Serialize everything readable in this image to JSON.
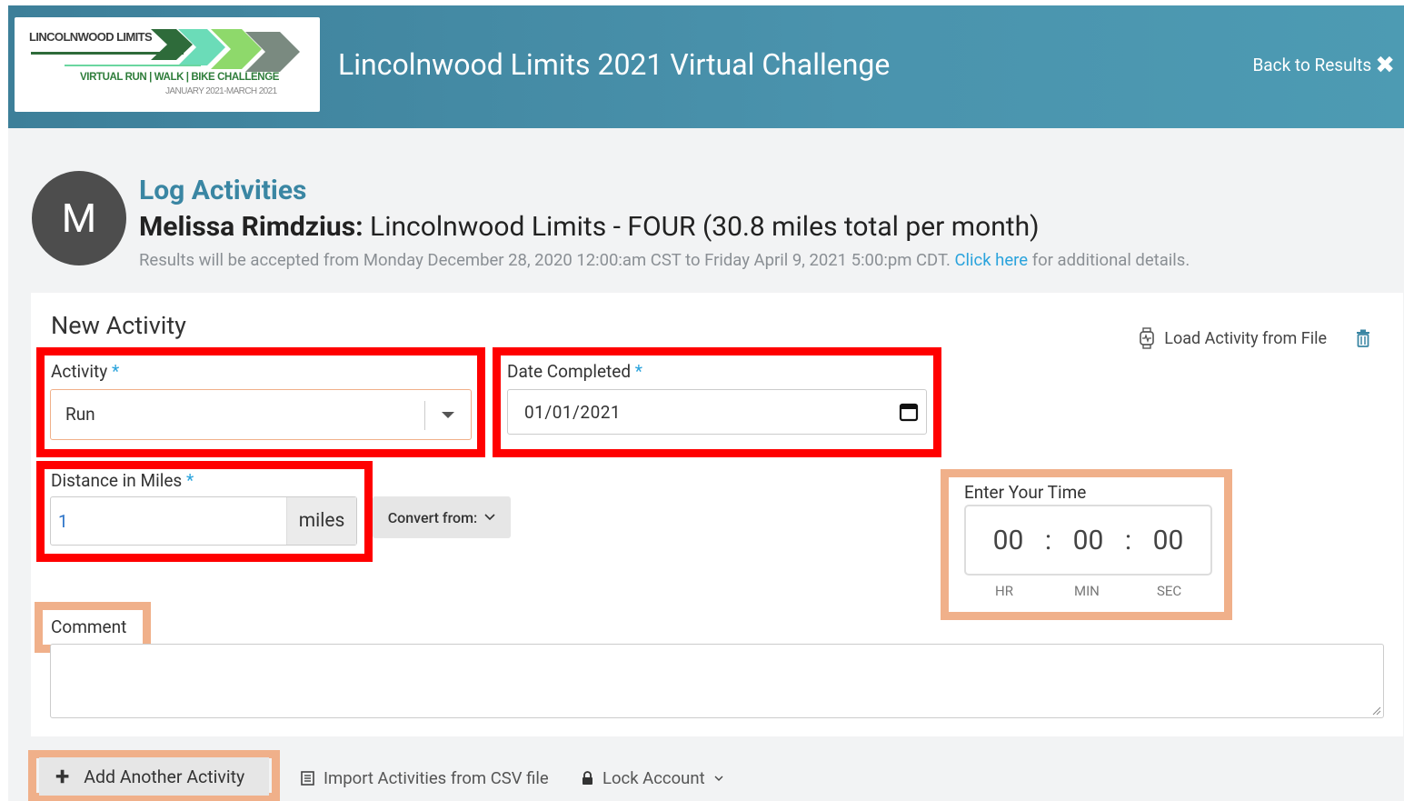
{
  "header": {
    "logo": {
      "title": "LINCOLNWOOD LIMITS",
      "subtitle": "VIRTUAL RUN | WALK | BIKE CHALLENGE",
      "dates": "JANUARY 2021-MARCH 2021"
    },
    "title": "Lincolnwood Limits 2021 Virtual Challenge",
    "back_label": "Back to Results",
    "back_icon": "close-icon"
  },
  "profile": {
    "avatar_initial": "M",
    "section_title": "Log Activities",
    "user_name": "Melissa Rimdzius:",
    "team": "Lincolnwood Limits - FOUR (30.8 miles total per month)",
    "note_before": "Results will be accepted from Monday December 28, 2020 12:00:am CST to Friday April 9, 2021 5:00:pm CDT. ",
    "note_link": "Click here",
    "note_after": " for additional details."
  },
  "form": {
    "title": "New Activity",
    "load_file_label": "Load Activity from File",
    "activity": {
      "label": "Activity",
      "required_mark": "*",
      "value": "Run"
    },
    "date": {
      "label": "Date Completed",
      "required_mark": "*",
      "value": "01/01/2021"
    },
    "distance": {
      "label": "Distance in Miles",
      "required_mark": "*",
      "value": "1",
      "unit": "miles",
      "convert_label": "Convert from:"
    },
    "time": {
      "label": "Enter Your Time",
      "hours": "00",
      "minutes": "00",
      "seconds": "00",
      "separator": ":",
      "hr_label": "HR",
      "min_label": "MIN",
      "sec_label": "SEC"
    },
    "comment": {
      "label": "Comment",
      "value": ""
    }
  },
  "footer": {
    "add_label": "Add Another Activity",
    "import_label": "Import Activities from CSV file",
    "lock_label": "Lock Account"
  },
  "colors": {
    "header": "#4a93ad",
    "title_blue": "#3a86a3",
    "link": "#2aa3dc",
    "highlight_red": "#ff0000",
    "highlight_orange": "#f0b08a"
  }
}
